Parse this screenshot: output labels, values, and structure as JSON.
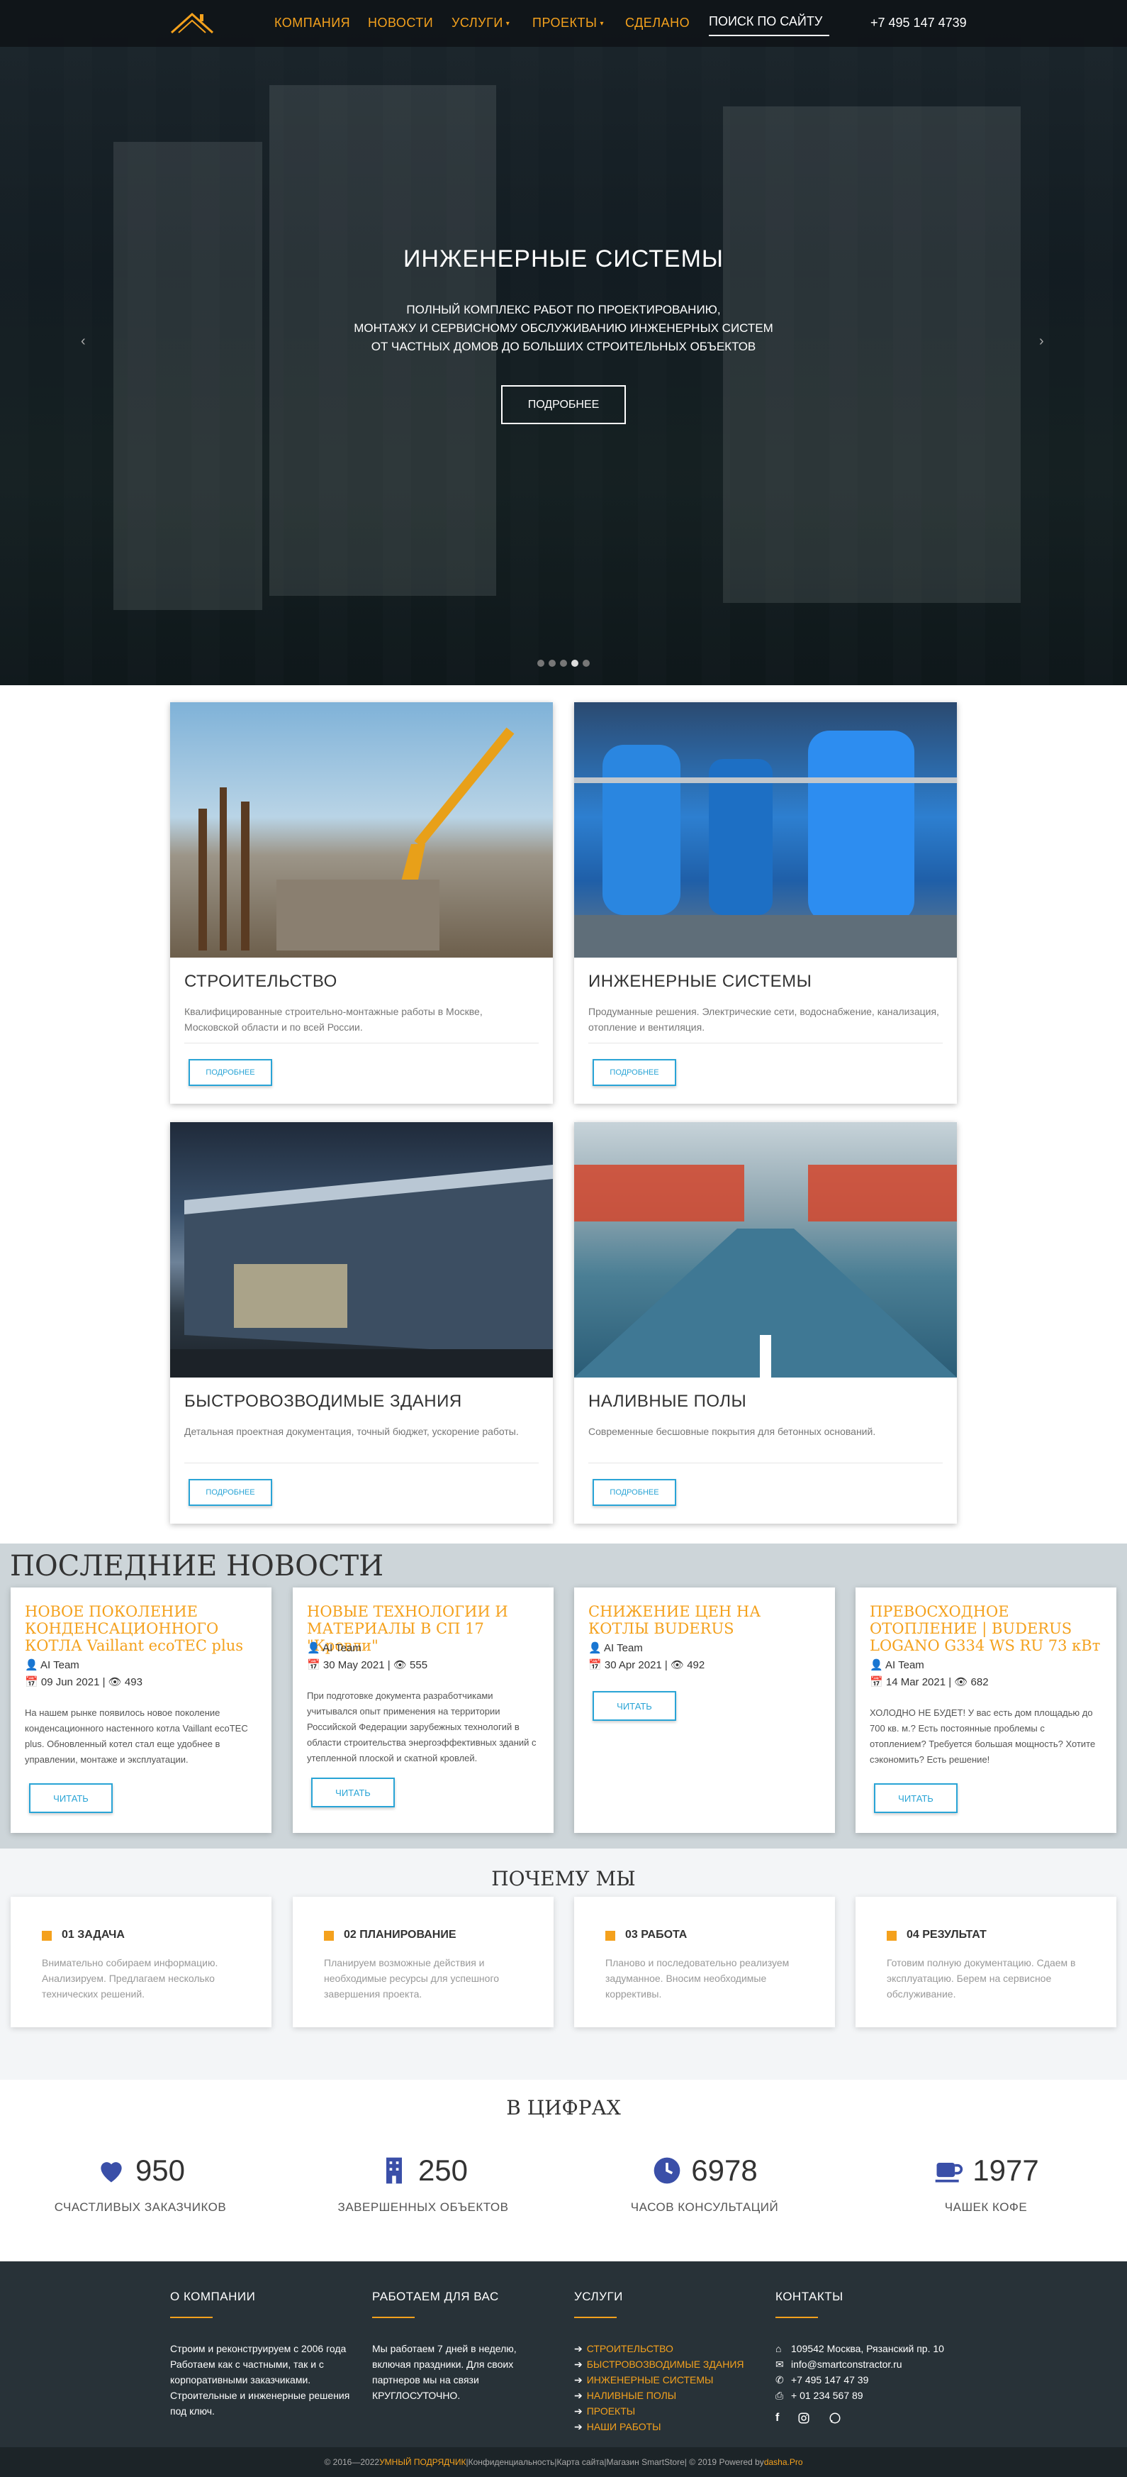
{
  "nav": {
    "items": [
      "КОМПАНИЯ",
      "НОВОСТИ",
      "УСЛУГИ",
      "ПРОЕКТЫ",
      "СДЕЛАНО"
    ],
    "dropdown_caret": "▾",
    "search_placeholder": "ПОИСК ПО САЙТУ",
    "phone": "+7 495 147 4739",
    "accent": "#f4a11d"
  },
  "hero": {
    "title": "ИНЖЕНЕРНЫЕ СИСТЕМЫ",
    "subtitle_lines": [
      "ПОЛНЫЙ КОМПЛЕКС РАБОТ ПО ПРОЕКТИРОВАНИЮ,",
      "МОНТАЖУ И СЕРВИСНОМУ ОБСЛУЖИВАНИЮ ИНЖЕНЕРНЫХ СИСТЕМ",
      "ОТ ЧАСТНЫХ ДОМОВ ДО БОЛЬШИХ СТРОИТЕЛЬНЫХ ОБЪЕКТОВ"
    ],
    "button": "ПОДРОБНЕЕ",
    "prev": "‹",
    "next": "›",
    "slides": 5,
    "active_slide": 4
  },
  "services": [
    {
      "title": "СТРОИТЕЛЬСТВО",
      "text": "Квалифицированные строительно-монтажные работы в Москве, Московской области и по всей России.",
      "button": "ПОДРОБНЕЕ"
    },
    {
      "title": "ИНЖЕНЕРНЫЕ СИСТЕМЫ",
      "text": "Продуманные решения. Электрические сети, водоснабжение, канализация, отопление и вентиляция.",
      "button": "ПОДРОБНЕЕ"
    },
    {
      "title": "БЫСТРОВОЗВОДИМЫЕ ЗДАНИЯ",
      "text": "Детальная проектная документация, точный бюджет, ускорение работы.",
      "button": "ПОДРОБНЕЕ"
    },
    {
      "title": "НАЛИВНЫЕ ПОЛЫ",
      "text": "Современные бесшовные покрытия для бетонных оснований.",
      "button": "ПОДРОБНЕЕ"
    }
  ],
  "news": {
    "heading": "ПОСЛЕДНИЕ НОВОСТИ",
    "items": [
      {
        "title": "НОВОЕ ПОКОЛЕНИЕ КОНДЕНСАЦИОННОГО КОТЛА Vaillant ecoTEC plus",
        "author": "AI Team",
        "date": "09 Jun 2021",
        "views": "493",
        "text": "На нашем рынке появилось новое поколение конденсационного настенного котла Vaillant ecoTEC plus. Обновленный котел стал еще удобнее в управлении, монтаже и эксплуатации.",
        "button": "ЧИТАТЬ"
      },
      {
        "title": "НОВЫЕ ТЕХНОЛОГИИ И МАТЕРИАЛЫ В СП 17 \"Кровли\"",
        "author": "AI Team",
        "date": "30 May 2021",
        "views": "555",
        "text": "При подготовке документа разработчиками учитывался опыт применения на территории Российской Федерации зарубежных технологий в области строительства энергоэффективных зданий с утепленной плоской и скатной кровлей.",
        "button": "ЧИТАТЬ"
      },
      {
        "title": "СНИЖЕНИЕ ЦЕН НА КОТЛЫ BUDERUS",
        "author": "AI Team",
        "date": "30 Apr 2021",
        "views": "492",
        "text": "",
        "button": "ЧИТАТЬ"
      },
      {
        "title": "ПРЕВОСХОДНОЕ ОТОПЛЕНИЕ | BUDERUS LOGANO G334 WS RU 73 кВт",
        "author": "AI Team",
        "date": "14 Mar 2021",
        "views": "682",
        "text": "ХОЛОДНО НЕ БУДЕТ! У вас есть дом площадью до 700 кв. м.? Есть постоянные проблемы с отоплением? Требуется большая мощность? Хотите сэкономить? Есть решение!",
        "button": "ЧИТАТЬ"
      }
    ]
  },
  "why": {
    "heading": "ПОЧЕМУ МЫ",
    "items": [
      {
        "title": "01 ЗАДАЧА",
        "text": "Внимательно собираем информацию. Анализируем. Предлагаем несколько технических решений."
      },
      {
        "title": "02 ПЛАНИРОВАНИЕ",
        "text": "Планируем возможные действия и необходимые ресурсы для успешного завершения проекта."
      },
      {
        "title": "03 РАБОТА",
        "text": "Планово и последовательно реализуем задуманное. Вносим необходимые коррективы."
      },
      {
        "title": "04 РЕЗУЛЬТАТ",
        "text": "Готовим полную документацию. Сдаем в эксплуатацию. Берем на сервисное обслуживание."
      }
    ]
  },
  "numbers": {
    "heading": "В ЦИФРАХ",
    "icon_color": "#3a4fa8",
    "items": [
      {
        "value": "950",
        "label": "СЧАСТЛИВЫХ ЗАКАЗЧИКОВ",
        "icon": "heart-icon"
      },
      {
        "value": "250",
        "label": "ЗАВЕРШЕННЫХ ОБЪЕКТОВ",
        "icon": "building-icon"
      },
      {
        "value": "6978",
        "label": "ЧАСОВ КОНСУЛЬТАЦИЙ",
        "icon": "clock-icon"
      },
      {
        "value": "1977",
        "label": "ЧАШЕК КОФЕ",
        "icon": "coffee-icon"
      }
    ]
  },
  "footer": {
    "about": {
      "heading": "О КОМПАНИИ",
      "text": "Строим и реконструируем с 2006 года Работаем как с частными, так и с корпоративными заказчиками. Строительные и инженерные решения под ключ."
    },
    "work": {
      "heading": "РАБОТАЕМ ДЛЯ ВАС",
      "text": "Мы работаем 7 дней в неделю, включая праздники. Для своих партнеров мы на связи КРУГЛОСУТОЧНО."
    },
    "services": {
      "heading": "УСЛУГИ",
      "links": [
        "СТРОИТЕЛЬСТВО",
        "БЫСТРОВОЗВОДИМЫЕ ЗДАНИЯ",
        "ИНЖЕНЕРНЫЕ СИСТЕМЫ",
        "НАЛИВНЫЕ ПОЛЫ",
        "ПРОЕКТЫ",
        "НАШИ РАБОТЫ"
      ]
    },
    "contacts": {
      "heading": "КОНТАКТЫ",
      "address": "109542 Москва, Рязанский пр. 10",
      "email": "info@smartconstractor.ru",
      "phone": "+7 495 147 47 39",
      "fax": "+ 01 234 567 89"
    },
    "bottom": {
      "prefix": "© 2016—2022 ",
      "brand": "УМНЫЙ ПОДРЯДЧИК",
      "sep1": " | ",
      "link1": "Конфиденциальность",
      "sep2": " | ",
      "link2": "Карта сайта",
      "sep3": " | ",
      "link3": "Магазин SmartStore",
      "suffix": " | © 2019 Powered by ",
      "powered": "dasha.Pro"
    }
  }
}
